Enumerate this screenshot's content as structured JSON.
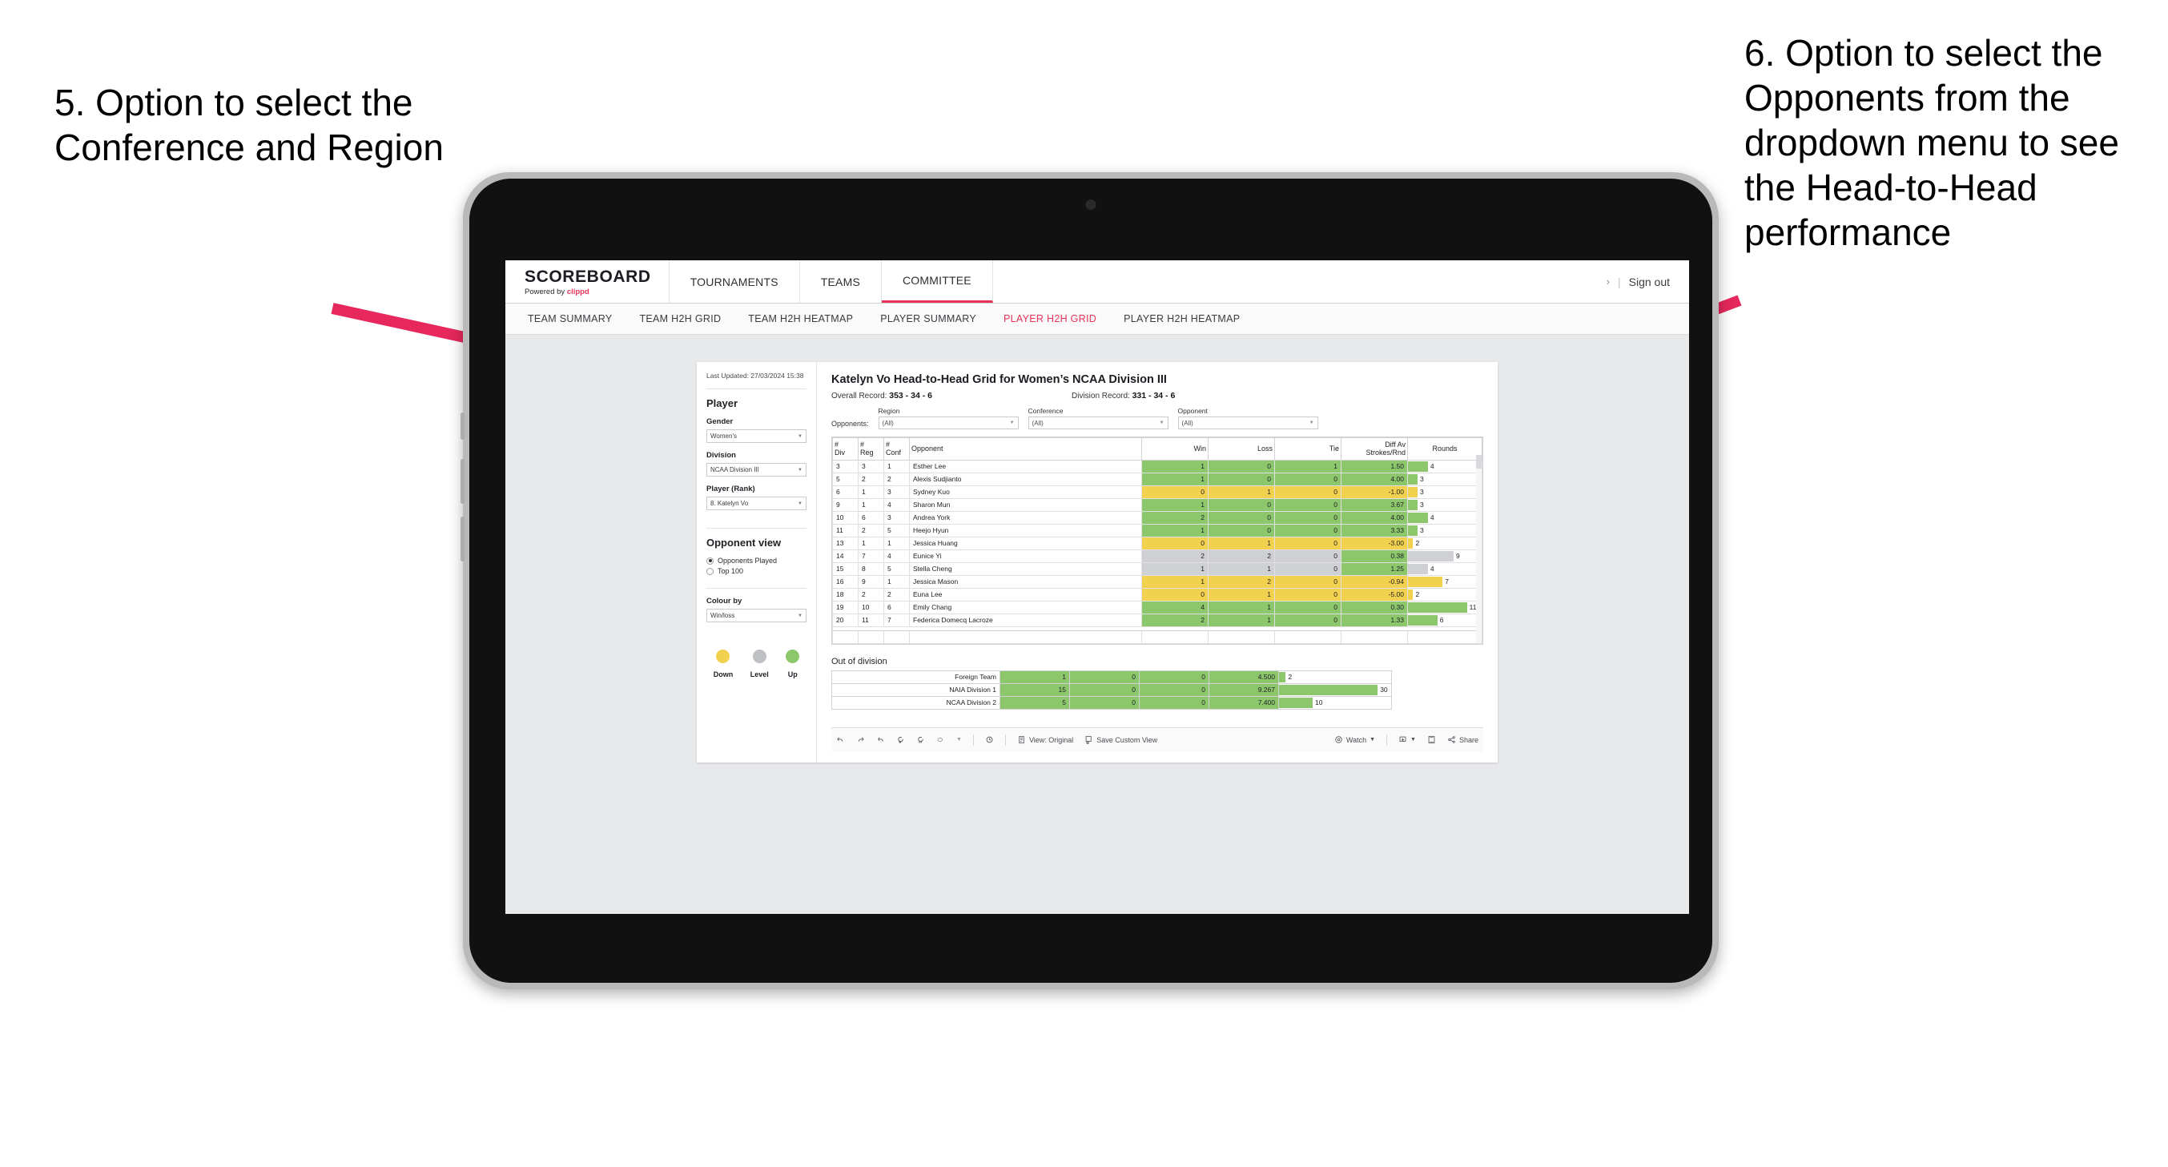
{
  "annotations": {
    "left": "5. Option to select the Conference and Region",
    "right": "6. Option to select the Opponents from the dropdown menu to see the Head-to-Head performance",
    "arrow_color": "#E6285C"
  },
  "app": {
    "brand": {
      "logo": "SCOREBOARD",
      "powered_prefix": "Powered by ",
      "powered_brand": "clippd"
    },
    "topnav": {
      "tabs": [
        {
          "label": "TOURNAMENTS",
          "active": false
        },
        {
          "label": "TEAMS",
          "active": false
        },
        {
          "label": "COMMITTEE",
          "active": true
        }
      ],
      "chevron": "›",
      "separator": "|",
      "signout": "Sign out"
    },
    "subnav": [
      {
        "label": "TEAM SUMMARY",
        "active": false
      },
      {
        "label": "TEAM H2H GRID",
        "active": false
      },
      {
        "label": "TEAM H2H HEATMAP",
        "active": false
      },
      {
        "label": "PLAYER SUMMARY",
        "active": false
      },
      {
        "label": "PLAYER H2H GRID",
        "active": true
      },
      {
        "label": "PLAYER H2H HEATMAP",
        "active": false
      }
    ]
  },
  "panel": {
    "last_updated": "Last Updated: 27/03/2024 15:38",
    "player_heading": "Player",
    "gender": {
      "label": "Gender",
      "value": "Women’s"
    },
    "division": {
      "label": "Division",
      "value": "NCAA Division III"
    },
    "player_rank": {
      "label": "Player (Rank)",
      "value": "8. Katelyn Vo"
    },
    "opponent_view": {
      "heading": "Opponent view",
      "options": [
        {
          "label": "Opponents Played",
          "selected": true
        },
        {
          "label": "Top 100",
          "selected": false
        }
      ]
    },
    "colour_by": {
      "label": "Colour by",
      "value": "Win/loss"
    },
    "legend": [
      {
        "label": "Down",
        "color": "#F2D14E"
      },
      {
        "label": "Level",
        "color": "#BFC0C4"
      },
      {
        "label": "Up",
        "color": "#8CC76B"
      }
    ]
  },
  "main": {
    "title": "Katelyn Vo Head-to-Head Grid for Women’s NCAA Division III",
    "overall_record_label": "Overall Record: ",
    "overall_record_value": "353 - 34 - 6",
    "division_record_label": "Division Record: ",
    "division_record_value": "331 - 34 - 6",
    "filters": {
      "opponents_label": "Opponents:",
      "fields": [
        {
          "label": "Region",
          "value": "(All)"
        },
        {
          "label": "Conference",
          "value": "(All)"
        },
        {
          "label": "Opponent",
          "value": "(All)"
        }
      ]
    },
    "table": {
      "headers": [
        "# Div",
        "# Reg",
        "# Conf",
        "Opponent",
        "Win",
        "Loss",
        "Tie",
        "Diff Av Strokes/Rnd",
        "Rounds"
      ],
      "header_multiline": [
        [
          "#",
          "Div"
        ],
        [
          "#",
          "Reg"
        ],
        [
          "#",
          "Conf"
        ],
        [
          "Opponent"
        ],
        [
          "Win"
        ],
        [
          "Loss"
        ],
        [
          "Tie"
        ],
        [
          "Diff Av",
          "Strokes/Rnd"
        ],
        [
          "Rounds"
        ]
      ],
      "rows": [
        {
          "div": "3",
          "reg": "3",
          "conf": "1",
          "opponent": "Esther Lee",
          "win": "1",
          "loss": "0",
          "tie": "1",
          "diff": "1.50",
          "rounds": "4",
          "color": "#8CC76B",
          "bar_pct": 27
        },
        {
          "div": "5",
          "reg": "2",
          "conf": "2",
          "opponent": "Alexis Sudjianto",
          "win": "1",
          "loss": "0",
          "tie": "0",
          "diff": "4.00",
          "rounds": "3",
          "color": "#8CC76B",
          "bar_pct": 13
        },
        {
          "div": "6",
          "reg": "1",
          "conf": "3",
          "opponent": "Sydney Kuo",
          "win": "0",
          "loss": "1",
          "tie": "0",
          "diff": "-1.00",
          "rounds": "3",
          "color": "#F2D14E",
          "bar_pct": 13
        },
        {
          "div": "9",
          "reg": "1",
          "conf": "4",
          "opponent": "Sharon Mun",
          "win": "1",
          "loss": "0",
          "tie": "0",
          "diff": "3.67",
          "rounds": "3",
          "color": "#8CC76B",
          "bar_pct": 13
        },
        {
          "div": "10",
          "reg": "6",
          "conf": "3",
          "opponent": "Andrea York",
          "win": "2",
          "loss": "0",
          "tie": "0",
          "diff": "4.00",
          "rounds": "4",
          "color": "#8CC76B",
          "bar_pct": 27
        },
        {
          "div": "11",
          "reg": "2",
          "conf": "5",
          "opponent": "Heejo Hyun",
          "win": "1",
          "loss": "0",
          "tie": "0",
          "diff": "3.33",
          "rounds": "3",
          "color": "#8CC76B",
          "bar_pct": 13
        },
        {
          "div": "13",
          "reg": "1",
          "conf": "1",
          "opponent": "Jessica Huang",
          "win": "0",
          "loss": "1",
          "tie": "0",
          "diff": "-3.00",
          "rounds": "2",
          "color": "#F2D14E",
          "bar_pct": 7
        },
        {
          "div": "14",
          "reg": "7",
          "conf": "4",
          "opponent": "Eunice Yi",
          "win": "2",
          "loss": "2",
          "tie": "0",
          "diff": "0.38",
          "rounds": "9",
          "color": "#CFD0D4",
          "diff_color": "#8CC76B",
          "bar_pct": 62
        },
        {
          "div": "15",
          "reg": "8",
          "conf": "5",
          "opponent": "Stella Cheng",
          "win": "1",
          "loss": "1",
          "tie": "0",
          "diff": "1.25",
          "rounds": "4",
          "color": "#CFD0D4",
          "diff_color": "#8CC76B",
          "bar_pct": 27
        },
        {
          "div": "16",
          "reg": "9",
          "conf": "1",
          "opponent": "Jessica Mason",
          "win": "1",
          "loss": "2",
          "tie": "0",
          "diff": "-0.94",
          "rounds": "7",
          "color": "#F2D14E",
          "bar_pct": 47
        },
        {
          "div": "18",
          "reg": "2",
          "conf": "2",
          "opponent": "Euna Lee",
          "win": "0",
          "loss": "1",
          "tie": "0",
          "diff": "-5.00",
          "rounds": "2",
          "color": "#F2D14E",
          "bar_pct": 7
        },
        {
          "div": "19",
          "reg": "10",
          "conf": "6",
          "opponent": "Emily Chang",
          "win": "4",
          "loss": "1",
          "tie": "0",
          "diff": "0.30",
          "rounds": "11",
          "color": "#8CC76B",
          "bar_pct": 80
        },
        {
          "div": "20",
          "reg": "11",
          "conf": "7",
          "opponent": "Federica Domecq Lacroze",
          "win": "2",
          "loss": "1",
          "tie": "0",
          "diff": "1.33",
          "rounds": "6",
          "color": "#8CC76B",
          "bar_pct": 40
        }
      ]
    },
    "out_of_division": {
      "title": "Out of division",
      "rows": [
        {
          "name": "Foreign Team",
          "win": "1",
          "loss": "0",
          "tie": "0",
          "diff": "4.500",
          "rounds": "2",
          "color": "#8CC76B",
          "bar_pct": 6
        },
        {
          "name": "NAIA Division 1",
          "win": "15",
          "loss": "0",
          "tie": "0",
          "diff": "9.267",
          "rounds": "30",
          "color": "#8CC76B",
          "bar_pct": 88
        },
        {
          "name": "NCAA Division 2",
          "win": "5",
          "loss": "0",
          "tie": "0",
          "diff": "7.400",
          "rounds": "10",
          "color": "#8CC76B",
          "bar_pct": 30
        }
      ]
    },
    "toolbar": {
      "view_label": "View: Original",
      "save_label": "Save Custom View",
      "watch_label": "Watch",
      "share_label": "Share"
    }
  },
  "chart_data": {
    "type": "table",
    "title": "Katelyn Vo Head-to-Head Grid for Women’s NCAA Division III",
    "columns": [
      "# Div",
      "# Reg",
      "# Conf",
      "Opponent",
      "Win",
      "Loss",
      "Tie",
      "Diff Av Strokes/Rnd",
      "Rounds"
    ],
    "rows": [
      [
        "3",
        "3",
        "1",
        "Esther Lee",
        1,
        0,
        1,
        1.5,
        4
      ],
      [
        "5",
        "2",
        "2",
        "Alexis Sudjianto",
        1,
        0,
        0,
        4.0,
        3
      ],
      [
        "6",
        "1",
        "3",
        "Sydney Kuo",
        0,
        1,
        0,
        -1.0,
        3
      ],
      [
        "9",
        "1",
        "4",
        "Sharon Mun",
        1,
        0,
        0,
        3.67,
        3
      ],
      [
        "10",
        "6",
        "3",
        "Andrea York",
        2,
        0,
        0,
        4.0,
        4
      ],
      [
        "11",
        "2",
        "5",
        "Heejo Hyun",
        1,
        0,
        0,
        3.33,
        3
      ],
      [
        "13",
        "1",
        "1",
        "Jessica Huang",
        0,
        1,
        0,
        -3.0,
        2
      ],
      [
        "14",
        "7",
        "4",
        "Eunice Yi",
        2,
        2,
        0,
        0.38,
        9
      ],
      [
        "15",
        "8",
        "5",
        "Stella Cheng",
        1,
        1,
        0,
        1.25,
        4
      ],
      [
        "16",
        "9",
        "1",
        "Jessica Mason",
        1,
        2,
        0,
        -0.94,
        7
      ],
      [
        "18",
        "2",
        "2",
        "Euna Lee",
        0,
        1,
        0,
        -5.0,
        2
      ],
      [
        "19",
        "10",
        "6",
        "Emily Chang",
        4,
        1,
        0,
        0.3,
        11
      ],
      [
        "20",
        "11",
        "7",
        "Federica Domecq Lacroze",
        2,
        1,
        0,
        1.33,
        6
      ]
    ],
    "out_of_division_rows": [
      [
        "Foreign Team",
        1,
        0,
        0,
        4.5,
        2
      ],
      [
        "NAIA Division 1",
        15,
        0,
        0,
        9.267,
        30
      ],
      [
        "NCAA Division 2",
        5,
        0,
        0,
        7.4,
        10
      ]
    ],
    "colour_by": "Win/loss",
    "legend": [
      {
        "label": "Down",
        "color": "#F2D14E"
      },
      {
        "label": "Level",
        "color": "#BFC0C4"
      },
      {
        "label": "Up",
        "color": "#8CC76B"
      }
    ]
  }
}
